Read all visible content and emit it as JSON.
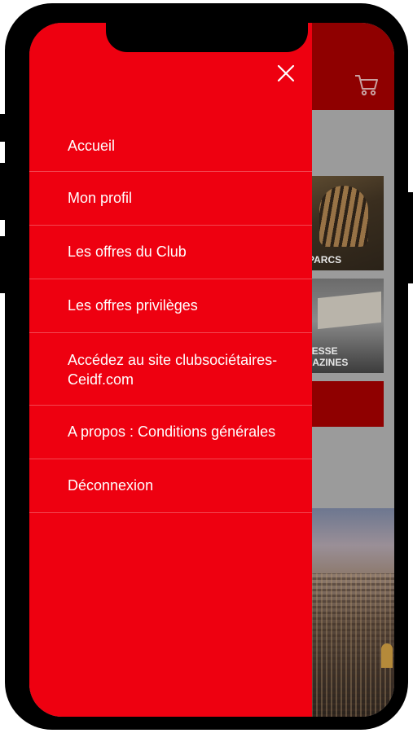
{
  "drawer": {
    "close_label": "×",
    "items": [
      {
        "label": "Accueil"
      },
      {
        "label": "Mon profil"
      },
      {
        "label": "Les offres du Club"
      },
      {
        "label": "Les offres privilèges"
      },
      {
        "label": "Accédez au site clubsociétaires-Ceidf.com"
      },
      {
        "label": "A propos : Conditions générales"
      },
      {
        "label": "Déconnexion"
      }
    ]
  },
  "background": {
    "tile1_label": "PARCS",
    "tile2_label_line1": "RESSE",
    "tile2_label_line2": "GAZINES",
    "cart_icon": "cart-icon"
  },
  "colors": {
    "drawer": "#ee0010",
    "header_dimmed": "#8f0000",
    "text": "#ffffff"
  }
}
